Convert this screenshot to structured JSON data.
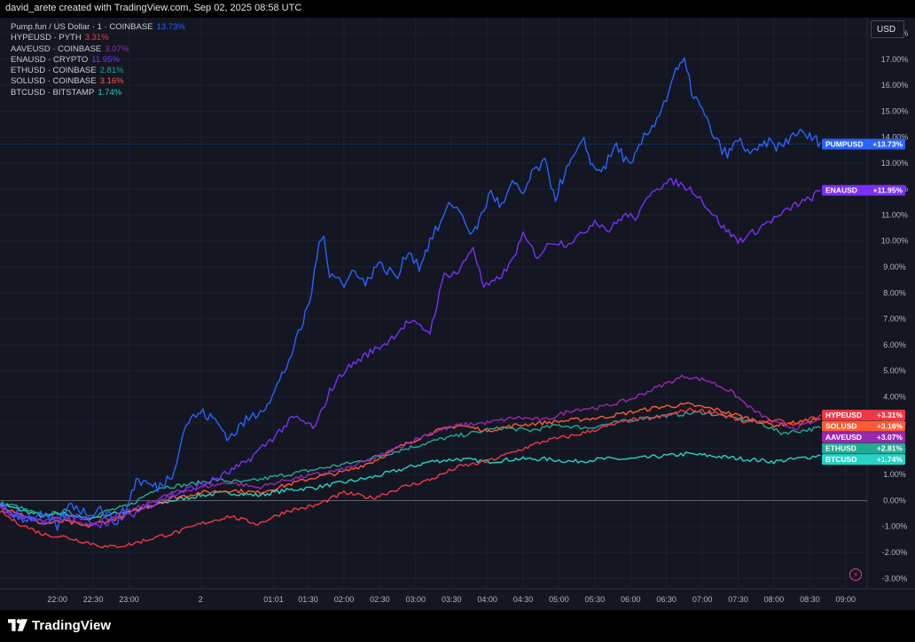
{
  "header": {
    "credit": "david_arete created with TradingView.com, Sep 02, 2025 08:58 UTC"
  },
  "scale_button": "USD",
  "brand": "TradingView",
  "icons": {
    "logo": "tradingview-logo-icon",
    "alert": "lightning-icon"
  },
  "chart_data": {
    "type": "line",
    "x_ticks": [
      "22:00",
      "22:30",
      "23:00",
      "2",
      "01:01",
      "01:30",
      "02:00",
      "02:30",
      "03:00",
      "03:30",
      "04:00",
      "04:30",
      "05:00",
      "05:30",
      "06:00",
      "06:30",
      "07:00",
      "07:30",
      "08:00",
      "08:30",
      "09:00"
    ],
    "x_range_hours": [
      -2.8,
      9.3
    ],
    "y_ticks": [
      "18.00%",
      "17.00%",
      "16.00%",
      "15.00%",
      "14.00%",
      "13.00%",
      "12.00%",
      "11.00%",
      "10.00%",
      "9.00%",
      "8.00%",
      "7.00%",
      "6.00%",
      "5.00%",
      "4.00%",
      "3.00%",
      "2.00%",
      "1.00%",
      "0.00%",
      "-1.00%",
      "-2.00%",
      "-3.00%"
    ],
    "ylim": [
      -3.4,
      18.6
    ],
    "grid": true,
    "legend_placement": "top-left",
    "series": [
      {
        "name": "Pump.fun / US Dollar · 1 · COINBASE",
        "value_label": "13.73%",
        "tag": "PUMPUSD",
        "tag_value": "+13.73%",
        "color": "#2962ff",
        "points": [
          [
            -3.0,
            0.0
          ],
          [
            -2.7,
            -0.4
          ],
          [
            -2.45,
            -0.7
          ],
          [
            -2.2,
            -0.6
          ],
          [
            -2.0,
            -1.0
          ],
          [
            -1.8,
            -0.1
          ],
          [
            -1.6,
            -0.5
          ],
          [
            -1.4,
            -0.3
          ],
          [
            -1.2,
            -0.8
          ],
          [
            -1.05,
            -0.4
          ],
          [
            -0.9,
            0.8
          ],
          [
            -0.6,
            0.5
          ],
          [
            -0.4,
            1.0
          ],
          [
            -0.2,
            3.0
          ],
          [
            0.0,
            3.4
          ],
          [
            0.2,
            3.1
          ],
          [
            0.4,
            2.4
          ],
          [
            0.6,
            3.0
          ],
          [
            0.8,
            3.4
          ],
          [
            1.0,
            4.0
          ],
          [
            1.2,
            5.2
          ],
          [
            1.4,
            6.6
          ],
          [
            1.55,
            8.0
          ],
          [
            1.62,
            9.5
          ],
          [
            1.72,
            10.2
          ],
          [
            1.8,
            8.8
          ],
          [
            1.9,
            8.7
          ],
          [
            2.0,
            8.2
          ],
          [
            2.15,
            9.0
          ],
          [
            2.3,
            8.3
          ],
          [
            2.45,
            9.1
          ],
          [
            2.6,
            8.9
          ],
          [
            2.75,
            8.6
          ],
          [
            2.9,
            9.7
          ],
          [
            3.05,
            9.0
          ],
          [
            3.2,
            10.0
          ],
          [
            3.35,
            10.7
          ],
          [
            3.5,
            11.5
          ],
          [
            3.65,
            11.0
          ],
          [
            3.8,
            10.2
          ],
          [
            3.95,
            11.2
          ],
          [
            4.05,
            11.9
          ],
          [
            4.2,
            11.3
          ],
          [
            4.35,
            12.2
          ],
          [
            4.5,
            11.8
          ],
          [
            4.65,
            12.7
          ],
          [
            4.8,
            13.0
          ],
          [
            4.95,
            11.7
          ],
          [
            5.05,
            12.4
          ],
          [
            5.2,
            13.2
          ],
          [
            5.35,
            13.8
          ],
          [
            5.5,
            12.7
          ],
          [
            5.65,
            12.9
          ],
          [
            5.8,
            13.7
          ],
          [
            6.0,
            12.8
          ],
          [
            6.15,
            13.8
          ],
          [
            6.3,
            14.4
          ],
          [
            6.5,
            15.5
          ],
          [
            6.6,
            16.4
          ],
          [
            6.75,
            16.9
          ],
          [
            6.85,
            15.8
          ],
          [
            7.0,
            15.0
          ],
          [
            7.2,
            13.8
          ],
          [
            7.35,
            13.3
          ],
          [
            7.5,
            13.9
          ],
          [
            7.7,
            13.3
          ],
          [
            7.9,
            13.8
          ],
          [
            8.1,
            13.6
          ],
          [
            8.3,
            14.2
          ],
          [
            8.5,
            14.0
          ],
          [
            8.65,
            13.8
          ]
        ]
      },
      {
        "name": "HYPEUSD · PYTH",
        "value_label": "3.31%",
        "tag": "HYPEUSD",
        "tag_value": "+3.31%",
        "color": "#f23645",
        "points": [
          [
            -3.0,
            0.0
          ],
          [
            -2.6,
            -0.8
          ],
          [
            -2.2,
            -1.3
          ],
          [
            -1.9,
            -1.4
          ],
          [
            -1.6,
            -1.6
          ],
          [
            -1.3,
            -1.8
          ],
          [
            -1.0,
            -1.7
          ],
          [
            -0.6,
            -1.4
          ],
          [
            -0.3,
            -1.2
          ],
          [
            0.0,
            -0.9
          ],
          [
            0.4,
            -0.6
          ],
          [
            0.8,
            -0.9
          ],
          [
            1.2,
            -0.4
          ],
          [
            1.6,
            -0.2
          ],
          [
            2.0,
            0.3
          ],
          [
            2.4,
            0.1
          ],
          [
            2.8,
            0.5
          ],
          [
            3.2,
            0.8
          ],
          [
            3.6,
            1.3
          ],
          [
            4.0,
            1.5
          ],
          [
            4.4,
            1.9
          ],
          [
            4.8,
            2.3
          ],
          [
            5.2,
            2.5
          ],
          [
            5.6,
            2.8
          ],
          [
            6.0,
            3.1
          ],
          [
            6.4,
            3.2
          ],
          [
            6.8,
            3.5
          ],
          [
            7.2,
            3.4
          ],
          [
            7.6,
            3.0
          ],
          [
            8.0,
            3.1
          ],
          [
            8.3,
            2.9
          ],
          [
            8.65,
            3.3
          ]
        ]
      },
      {
        "name": "AAVEUSD · COINBASE",
        "value_label": "3.07%",
        "tag": "AAVEUSD",
        "tag_value": "+3.07%",
        "color": "#9c27b0",
        "points": [
          [
            -3.0,
            0.0
          ],
          [
            -2.6,
            -0.6
          ],
          [
            -2.2,
            -0.8
          ],
          [
            -1.9,
            -0.7
          ],
          [
            -1.6,
            -0.9
          ],
          [
            -1.2,
            -0.6
          ],
          [
            -0.8,
            -0.2
          ],
          [
            -0.4,
            0.3
          ],
          [
            0.0,
            0.5
          ],
          [
            0.4,
            0.7
          ],
          [
            0.8,
            0.5
          ],
          [
            1.2,
            0.8
          ],
          [
            1.6,
            1.0
          ],
          [
            2.0,
            1.2
          ],
          [
            2.4,
            1.6
          ],
          [
            2.8,
            2.1
          ],
          [
            3.2,
            2.6
          ],
          [
            3.6,
            2.9
          ],
          [
            4.0,
            3.0
          ],
          [
            4.4,
            3.2
          ],
          [
            4.8,
            3.1
          ],
          [
            5.2,
            3.5
          ],
          [
            5.6,
            3.6
          ],
          [
            6.0,
            3.9
          ],
          [
            6.4,
            4.4
          ],
          [
            6.75,
            4.8
          ],
          [
            7.1,
            4.6
          ],
          [
            7.4,
            4.2
          ],
          [
            7.7,
            3.5
          ],
          [
            8.0,
            3.0
          ],
          [
            8.3,
            2.8
          ],
          [
            8.65,
            3.1
          ]
        ]
      },
      {
        "name": "ENAUSD · CRYPTO",
        "value_label": "11.95%",
        "tag": "ENAUSD",
        "tag_value": "+11.95%",
        "color": "#7b2ff7",
        "points": [
          [
            -3.0,
            0.0
          ],
          [
            -2.6,
            -0.5
          ],
          [
            -2.2,
            -0.8
          ],
          [
            -1.8,
            -0.6
          ],
          [
            -1.4,
            -0.9
          ],
          [
            -1.0,
            -0.6
          ],
          [
            -0.6,
            0.0
          ],
          [
            -0.2,
            0.4
          ],
          [
            0.2,
            0.8
          ],
          [
            0.6,
            1.4
          ],
          [
            1.0,
            2.4
          ],
          [
            1.3,
            3.2
          ],
          [
            1.6,
            2.8
          ],
          [
            1.8,
            4.2
          ],
          [
            2.0,
            5.0
          ],
          [
            2.3,
            5.6
          ],
          [
            2.6,
            6.1
          ],
          [
            2.9,
            6.9
          ],
          [
            3.2,
            6.5
          ],
          [
            3.4,
            8.7
          ],
          [
            3.6,
            8.8
          ],
          [
            3.8,
            9.8
          ],
          [
            3.95,
            8.2
          ],
          [
            4.1,
            8.4
          ],
          [
            4.3,
            9.0
          ],
          [
            4.5,
            10.2
          ],
          [
            4.7,
            9.4
          ],
          [
            4.9,
            10.0
          ],
          [
            5.1,
            9.9
          ],
          [
            5.3,
            10.2
          ],
          [
            5.5,
            10.8
          ],
          [
            5.7,
            10.4
          ],
          [
            5.9,
            11.0
          ],
          [
            6.1,
            10.9
          ],
          [
            6.3,
            12.0
          ],
          [
            6.6,
            12.3
          ],
          [
            6.9,
            11.9
          ],
          [
            7.1,
            11.2
          ],
          [
            7.3,
            10.5
          ],
          [
            7.5,
            10.0
          ],
          [
            7.7,
            10.3
          ],
          [
            7.9,
            10.7
          ],
          [
            8.1,
            11.0
          ],
          [
            8.3,
            11.4
          ],
          [
            8.5,
            11.6
          ],
          [
            8.65,
            11.95
          ]
        ]
      },
      {
        "name": "ETHUSD · COINBASE",
        "value_label": "2.81%",
        "tag": "ETHUSD",
        "tag_value": "+2.81%",
        "color": "#22ab94",
        "points": [
          [
            -3.0,
            0.0
          ],
          [
            -2.6,
            -0.2
          ],
          [
            -2.2,
            -0.6
          ],
          [
            -1.9,
            -0.4
          ],
          [
            -1.6,
            -0.7
          ],
          [
            -1.3,
            -0.4
          ],
          [
            -1.0,
            -0.2
          ],
          [
            -0.6,
            0.5
          ],
          [
            -0.2,
            0.6
          ],
          [
            0.2,
            0.8
          ],
          [
            0.6,
            0.7
          ],
          [
            1.0,
            0.9
          ],
          [
            1.4,
            1.1
          ],
          [
            1.8,
            1.3
          ],
          [
            2.2,
            1.5
          ],
          [
            2.6,
            1.8
          ],
          [
            3.0,
            2.1
          ],
          [
            3.4,
            2.4
          ],
          [
            3.8,
            2.6
          ],
          [
            4.2,
            2.8
          ],
          [
            4.6,
            2.7
          ],
          [
            5.0,
            2.9
          ],
          [
            5.4,
            2.8
          ],
          [
            5.8,
            3.0
          ],
          [
            6.2,
            3.2
          ],
          [
            6.6,
            3.3
          ],
          [
            7.0,
            3.4
          ],
          [
            7.4,
            3.2
          ],
          [
            7.8,
            3.0
          ],
          [
            8.1,
            2.6
          ],
          [
            8.4,
            2.7
          ],
          [
            8.65,
            2.8
          ]
        ]
      },
      {
        "name": "SOLUSD · COINBASE",
        "value_label": "3.16%",
        "tag": "SOLUSD",
        "tag_value": "+3.16%",
        "color": "#ff5a36",
        "points": [
          [
            -3.0,
            0.0
          ],
          [
            -2.6,
            -0.4
          ],
          [
            -2.2,
            -0.9
          ],
          [
            -1.9,
            -0.8
          ],
          [
            -1.6,
            -1.0
          ],
          [
            -1.2,
            -0.7
          ],
          [
            -0.8,
            -0.3
          ],
          [
            -0.4,
            0.1
          ],
          [
            0.0,
            0.3
          ],
          [
            0.4,
            0.4
          ],
          [
            0.8,
            0.3
          ],
          [
            1.2,
            0.6
          ],
          [
            1.6,
            0.9
          ],
          [
            2.0,
            1.1
          ],
          [
            2.4,
            1.5
          ],
          [
            2.8,
            2.1
          ],
          [
            3.2,
            2.6
          ],
          [
            3.6,
            2.9
          ],
          [
            4.0,
            2.7
          ],
          [
            4.4,
            2.9
          ],
          [
            4.8,
            3.0
          ],
          [
            5.2,
            3.1
          ],
          [
            5.6,
            3.2
          ],
          [
            6.0,
            3.4
          ],
          [
            6.4,
            3.6
          ],
          [
            6.8,
            3.7
          ],
          [
            7.2,
            3.5
          ],
          [
            7.6,
            3.2
          ],
          [
            8.0,
            2.9
          ],
          [
            8.3,
            3.0
          ],
          [
            8.65,
            3.16
          ]
        ]
      },
      {
        "name": "BTCUSD · BITSTAMP",
        "value_label": "1.74%",
        "tag": "BTCUSD",
        "tag_value": "+1.74%",
        "color": "#26d3c7",
        "points": [
          [
            -3.0,
            0.0
          ],
          [
            -2.6,
            -0.3
          ],
          [
            -2.2,
            -0.6
          ],
          [
            -1.9,
            -0.5
          ],
          [
            -1.6,
            -0.7
          ],
          [
            -1.2,
            -0.5
          ],
          [
            -0.8,
            -0.3
          ],
          [
            -0.4,
            0.0
          ],
          [
            0.0,
            0.2
          ],
          [
            0.4,
            0.3
          ],
          [
            0.8,
            0.2
          ],
          [
            1.2,
            0.4
          ],
          [
            1.6,
            0.5
          ],
          [
            2.0,
            0.7
          ],
          [
            2.4,
            0.9
          ],
          [
            2.8,
            1.2
          ],
          [
            3.2,
            1.5
          ],
          [
            3.6,
            1.6
          ],
          [
            4.0,
            1.5
          ],
          [
            4.4,
            1.6
          ],
          [
            4.8,
            1.6
          ],
          [
            5.2,
            1.5
          ],
          [
            5.6,
            1.6
          ],
          [
            6.0,
            1.6
          ],
          [
            6.4,
            1.7
          ],
          [
            6.8,
            1.8
          ],
          [
            7.2,
            1.7
          ],
          [
            7.6,
            1.6
          ],
          [
            8.0,
            1.5
          ],
          [
            8.3,
            1.6
          ],
          [
            8.65,
            1.74
          ]
        ]
      }
    ]
  }
}
